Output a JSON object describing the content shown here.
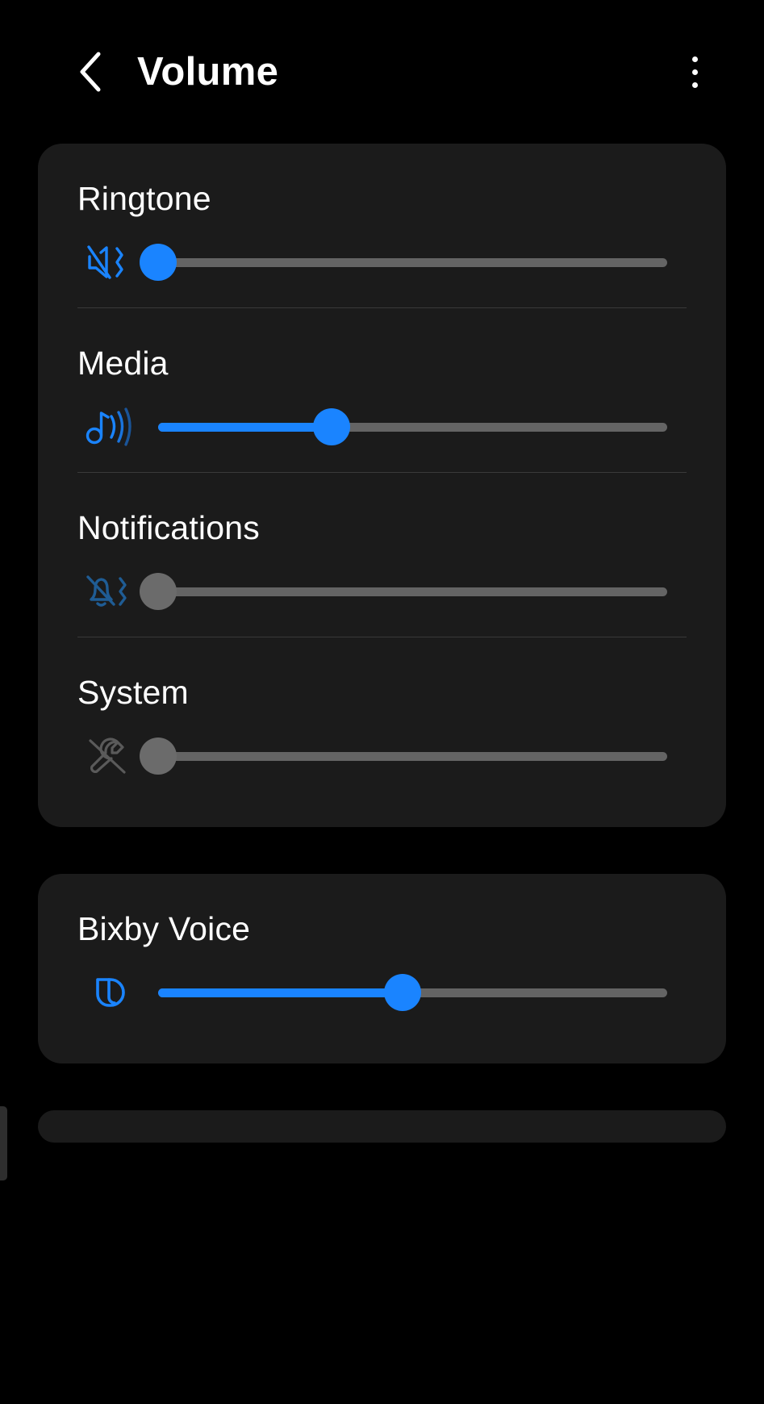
{
  "header": {
    "title": "Volume",
    "back_icon": "chevron-left-icon",
    "more_icon": "more-vertical-icon"
  },
  "colors": {
    "accent": "#1a84ff",
    "accent_dim": "#1f4f82",
    "track": "#646464",
    "thumb_off": "#6b6b6b",
    "card_bg": "#1b1b1b",
    "page_bg": "#000000",
    "icon_disabled": "#5a5a5a",
    "divider": "#3a3a3a"
  },
  "cards": [
    {
      "name": "main-volume-card",
      "groups": [
        {
          "key": "ringtone",
          "label": "Ringtone",
          "icon": "volume-mute-vibrate-icon",
          "icon_state": "active",
          "value": 0,
          "max": 100,
          "thumb_percent": 0,
          "thumb_state": "on",
          "divider_after": true
        },
        {
          "key": "media",
          "label": "Media",
          "icon": "music-note-waves-icon",
          "icon_state": "active",
          "value": 34,
          "max": 100,
          "thumb_percent": 34,
          "thumb_state": "on",
          "divider_after": true
        },
        {
          "key": "notifications",
          "label": "Notifications",
          "icon": "bell-mute-vibrate-icon",
          "icon_state": "dim",
          "value": 0,
          "max": 100,
          "thumb_percent": 0,
          "thumb_state": "off",
          "divider_after": true
        },
        {
          "key": "system",
          "label": "System",
          "icon": "wrench-muted-icon",
          "icon_state": "disabled",
          "value": 0,
          "max": 100,
          "thumb_percent": 0,
          "thumb_state": "off",
          "divider_after": false
        }
      ]
    },
    {
      "name": "bixby-voice-card",
      "groups": [
        {
          "key": "bixby_voice",
          "label": "Bixby Voice",
          "icon": "bixby-logo-icon",
          "icon_state": "active",
          "value": 48,
          "max": 100,
          "thumb_percent": 48,
          "thumb_state": "on",
          "divider_after": false
        }
      ]
    }
  ]
}
